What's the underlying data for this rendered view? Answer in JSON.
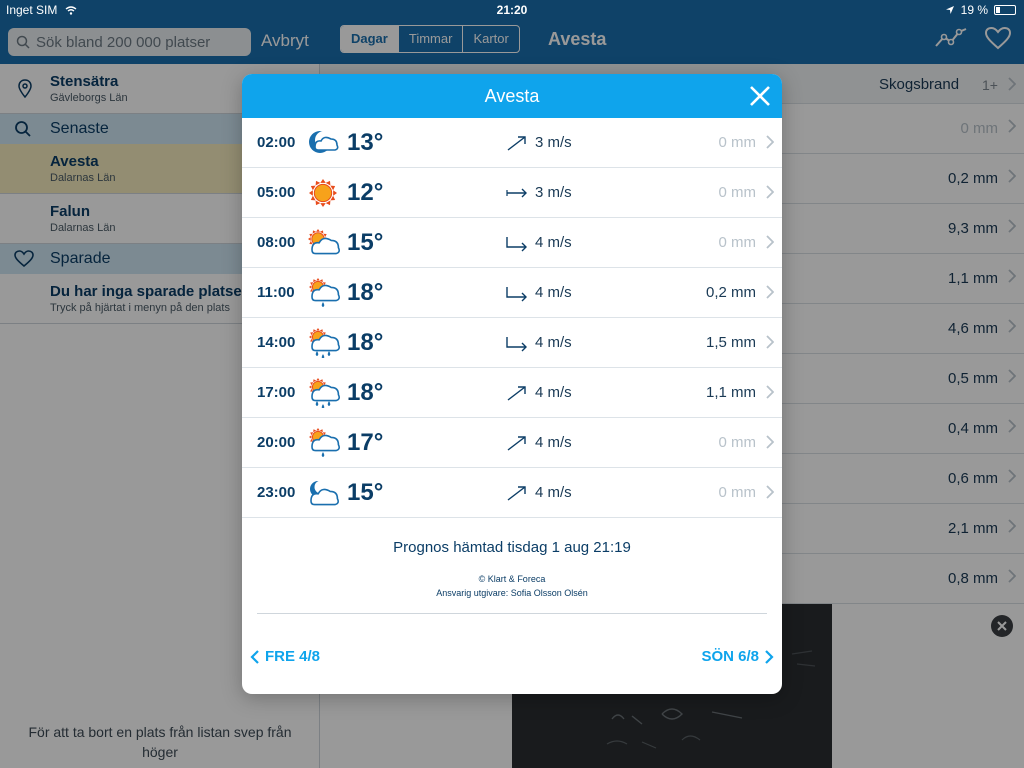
{
  "status": {
    "carrier": "Inget SIM",
    "time": "21:20",
    "battery": "19 %"
  },
  "sidebar": {
    "search_placeholder": "Sök bland 200 000 platser",
    "cancel": "Avbryt",
    "current": {
      "name": "Stensätra",
      "region": "Gävleborgs Län"
    },
    "recent_header": "Senaste",
    "recent": [
      {
        "name": "Avesta",
        "region": "Dalarnas Län"
      },
      {
        "name": "Falun",
        "region": "Dalarnas Län"
      }
    ],
    "saved_header": "Sparade",
    "saved_empty_title": "Du har inga sparade platser",
    "saved_empty_text": "Tryck på hjärtat i menyn på den plats",
    "footer": "För att ta bort en plats från listan svep från höger"
  },
  "main": {
    "tabs": [
      "Dagar",
      "Timmar",
      "Kartor"
    ],
    "title": "Avesta",
    "alert_label": "Skogsbrand",
    "alert_count": "1+",
    "precip_rows": [
      "0 mm",
      "0,2 mm",
      "9,3 mm",
      "1,1 mm",
      "4,6 mm",
      "0,5 mm",
      "0,4 mm",
      "0,6 mm",
      "2,1 mm",
      "0,8 mm"
    ]
  },
  "modal": {
    "title": "Avesta",
    "rows": [
      {
        "time": "02:00",
        "icon": "night-partly-cloudy-icon",
        "temp": "13°",
        "wind_dir": 45,
        "wind": "3 m/s",
        "precip": "0 mm"
      },
      {
        "time": "05:00",
        "icon": "sun-icon",
        "temp": "12°",
        "wind_dir": 90,
        "wind": "3 m/s",
        "precip": "0 mm"
      },
      {
        "time": "08:00",
        "icon": "partly-cloudy-icon",
        "temp": "15°",
        "wind_dir": 100,
        "wind": "4 m/s",
        "precip": "0 mm"
      },
      {
        "time": "11:00",
        "icon": "light-rain-icon",
        "temp": "18°",
        "wind_dir": 100,
        "wind": "4 m/s",
        "precip": "0,2 mm"
      },
      {
        "time": "14:00",
        "icon": "rain-icon",
        "temp": "18°",
        "wind_dir": 100,
        "wind": "4 m/s",
        "precip": "1,5 mm"
      },
      {
        "time": "17:00",
        "icon": "rain-icon",
        "temp": "18°",
        "wind_dir": 45,
        "wind": "4 m/s",
        "precip": "1,1 mm"
      },
      {
        "time": "20:00",
        "icon": "light-rain-icon",
        "temp": "17°",
        "wind_dir": 45,
        "wind": "4 m/s",
        "precip": "0 mm"
      },
      {
        "time": "23:00",
        "icon": "night-cloudy-icon",
        "temp": "15°",
        "wind_dir": 45,
        "wind": "4 m/s",
        "precip": "0 mm"
      }
    ],
    "fetched": "Prognos hämtad tisdag 1 aug 21:19",
    "credit": "© Klart & Foreca",
    "publisher": "Ansvarig utgivare: Sofia Olsson Olsén",
    "prev": "FRE 4/8",
    "next": "SÖN 6/8"
  },
  "colors": {
    "modal_header": "#0fa4ec",
    "app_header": "#1a6fae",
    "text_dark": "#0b3d66",
    "muted": "#b8c2ca"
  }
}
